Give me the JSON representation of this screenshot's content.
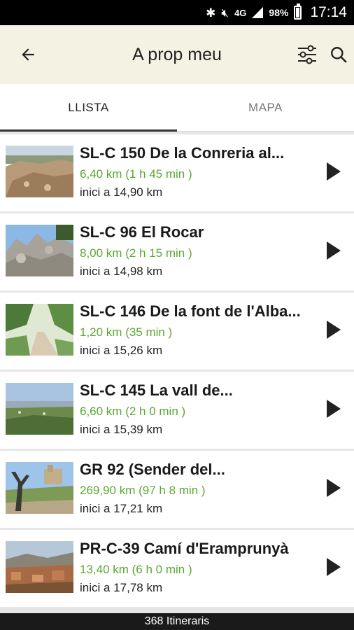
{
  "status_bar": {
    "network": "4G",
    "battery": "98%",
    "time": "17:14"
  },
  "app_bar": {
    "title": "A prop meu"
  },
  "tabs": [
    {
      "label": "LLISTA",
      "active": true
    },
    {
      "label": "MAPA",
      "active": false
    }
  ],
  "routes": [
    {
      "title": "SL-C 150 De la Conreria al...",
      "distance": "6,40 km (1 h 45 min )",
      "start": "inici a 14,90 km"
    },
    {
      "title": "SL-C 96 El Rocar",
      "distance": "8,00 km (2 h 15 min )",
      "start": "inici a 14,98 km"
    },
    {
      "title": "SL-C 146 De la font de l'Alba...",
      "distance": "1,20 km (35 min )",
      "start": "inici a 15,26 km"
    },
    {
      "title": "SL-C 145 La vall de...",
      "distance": "6,60 km (2 h 0 min )",
      "start": "inici a 15,39 km"
    },
    {
      "title": "GR 92 (Sender del...",
      "distance": "269,90 km (97 h 8 min )",
      "start": "inici a 17,21 km"
    },
    {
      "title": "PR-C-39 Camí d'Eramprunyà",
      "distance": "13,40 km (6 h 0 min )",
      "start": "inici a 17,78 km"
    }
  ],
  "footer": {
    "count": "368 Itineraris"
  },
  "colors": {
    "app_bar_bg": "#f4f2e2",
    "distance_green": "#5aa832",
    "status_bar_bg": "#000000"
  },
  "icons": {
    "back": "arrow-left-icon",
    "filter": "sliders-icon",
    "search": "search-icon",
    "item_action": "play-arrow-icon"
  }
}
